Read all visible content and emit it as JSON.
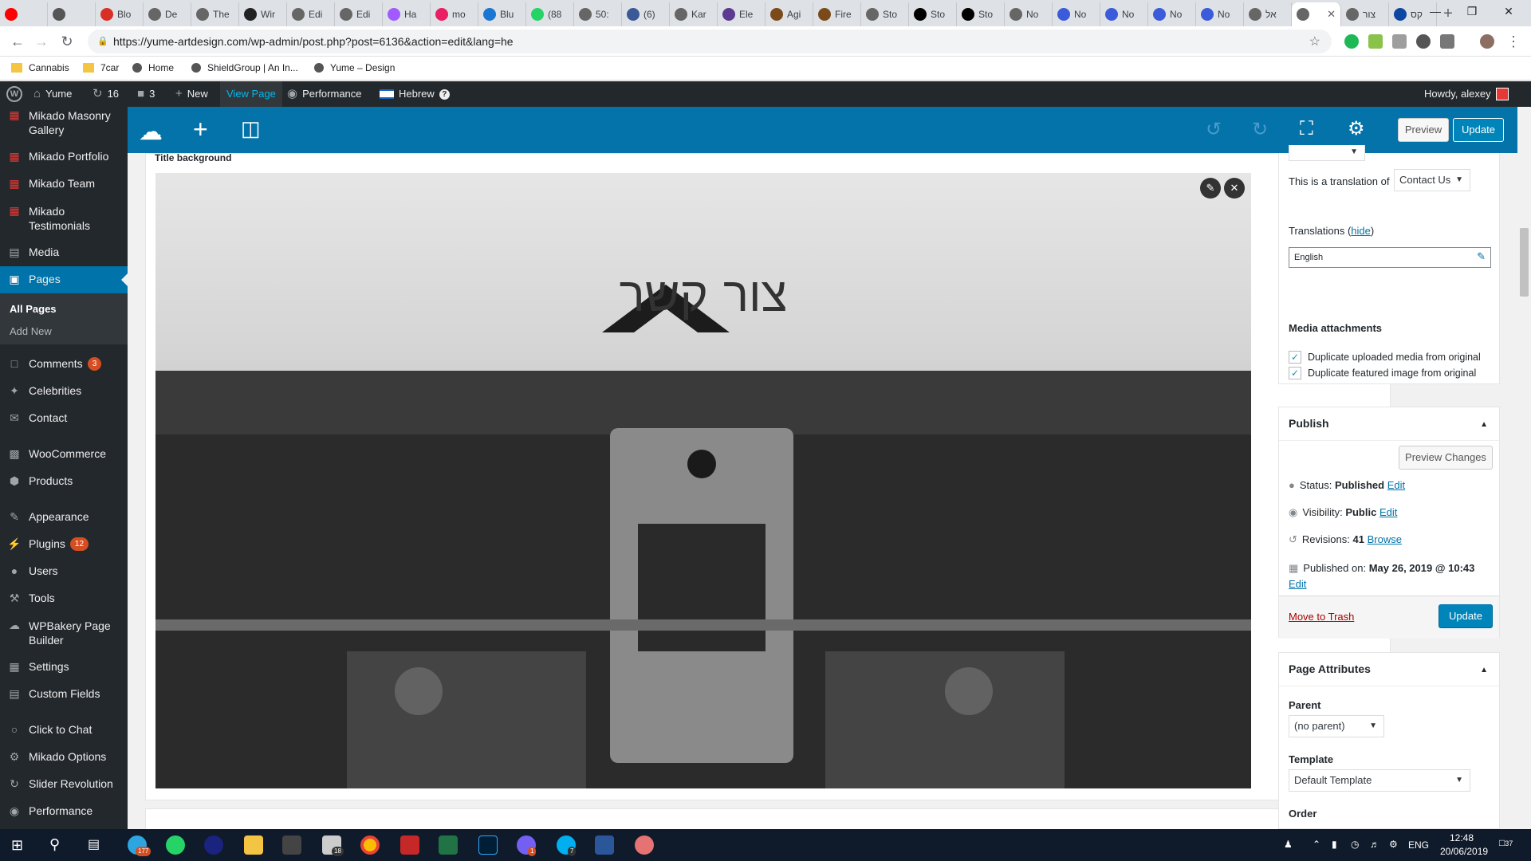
{
  "browser": {
    "tabs": [
      {
        "label": "",
        "color": "#ff0000"
      },
      {
        "label": "",
        "color": "#555"
      },
      {
        "label": "Blo",
        "color": "#d93025"
      },
      {
        "label": "De",
        "color": "#666"
      },
      {
        "label": "The",
        "color": "#666"
      },
      {
        "label": "Wir",
        "color": "#222"
      },
      {
        "label": "Edi",
        "color": "#666"
      },
      {
        "label": "Edi",
        "color": "#666"
      },
      {
        "label": "Ha",
        "color": "#a259ff"
      },
      {
        "label": "mo",
        "color": "#e91e63"
      },
      {
        "label": "Blu",
        "color": "#1976d2"
      },
      {
        "label": "(88",
        "color": "#25d366"
      },
      {
        "label": "50:",
        "color": "#666"
      },
      {
        "label": "(6)",
        "color": "#3b5998"
      },
      {
        "label": "Kar",
        "color": "#666"
      },
      {
        "label": "Ele",
        "color": "#5c3a91"
      },
      {
        "label": "Agi",
        "color": "#7a4a1a"
      },
      {
        "label": "Fire",
        "color": "#7a4a1a"
      },
      {
        "label": "Sto",
        "color": "#666"
      },
      {
        "label": "Sto",
        "color": "#000"
      },
      {
        "label": "Sto",
        "color": "#000"
      },
      {
        "label": "No",
        "color": "#666"
      },
      {
        "label": "No",
        "color": "#3b5bdb"
      },
      {
        "label": "No",
        "color": "#3b5bdb"
      },
      {
        "label": "No",
        "color": "#3b5bdb"
      },
      {
        "label": "No",
        "color": "#3b5bdb"
      },
      {
        "label": "אל",
        "color": "#666"
      },
      {
        "label": "",
        "color": "#666",
        "active": true
      },
      {
        "label": "צור",
        "color": "#666"
      },
      {
        "label": "קס",
        "color": "#0d47a1"
      }
    ],
    "url": "https://yume-artdesign.com/wp-admin/post.php?post=6136&action=edit&lang=he",
    "bookmarks": [
      "Cannabis",
      "7car",
      "Home",
      "ShieldGroup | An In...",
      "Yume – Design"
    ]
  },
  "adminbar": {
    "site": "Yume",
    "updates": "16",
    "comments": "3",
    "new": "New",
    "view": "View Page",
    "performance": "Performance",
    "language": "Hebrew",
    "howdy": "Howdy, alexey"
  },
  "sidebar": {
    "items": [
      {
        "label": "Mikado Masonry Gallery",
        "icon": "mikado-icon"
      },
      {
        "label": "Mikado Portfolio",
        "icon": "mikado-icon"
      },
      {
        "label": "Mikado Team",
        "icon": "mikado-icon"
      },
      {
        "label": "Mikado Testimonials",
        "icon": "mikado-icon"
      },
      {
        "label": "Media",
        "icon": "media-icon"
      },
      {
        "label": "Pages",
        "icon": "pages-icon"
      },
      {
        "label": "Comments",
        "icon": "comments-icon",
        "badge": "3"
      },
      {
        "label": "Celebrities",
        "icon": "pin-icon"
      },
      {
        "label": "Contact",
        "icon": "mail-icon"
      },
      {
        "label": "WooCommerce",
        "icon": "woo-icon"
      },
      {
        "label": "Products",
        "icon": "box-icon"
      },
      {
        "label": "Appearance",
        "icon": "brush-icon"
      },
      {
        "label": "Plugins",
        "icon": "plug-icon",
        "badge": "12"
      },
      {
        "label": "Users",
        "icon": "user-icon"
      },
      {
        "label": "Tools",
        "icon": "wrench-icon"
      },
      {
        "label": "WPBakery Page Builder",
        "icon": "wpb-icon"
      },
      {
        "label": "Settings",
        "icon": "settings-icon"
      },
      {
        "label": "Custom Fields",
        "icon": "fields-icon"
      },
      {
        "label": "Click to Chat",
        "icon": "chat-icon"
      },
      {
        "label": "Mikado Options",
        "icon": "gear-icon"
      },
      {
        "label": "Slider Revolution",
        "icon": "slider-icon"
      },
      {
        "label": "Performance",
        "icon": "performance-icon"
      }
    ],
    "pages_sub": [
      "All Pages",
      "Add New"
    ]
  },
  "builder": {
    "preview": "Preview",
    "update": "Update"
  },
  "content": {
    "title_bg_label": "Title background",
    "heading": "צור קשר"
  },
  "language_box": {
    "translation_of_label": "This is a translation of",
    "translation_of_value": "Contact Us",
    "translations_label": "Translations",
    "hide": "hide",
    "language_value": "English",
    "media_attachments": "Media attachments",
    "dup_media": "Duplicate uploaded media from original",
    "dup_featured": "Duplicate featured image from original"
  },
  "publish": {
    "title": "Publish",
    "preview_changes": "Preview Changes",
    "status_label": "Status:",
    "status_value": "Published",
    "visibility_label": "Visibility:",
    "visibility_value": "Public",
    "revisions_label": "Revisions:",
    "revisions_value": "41",
    "browse": "Browse",
    "published_on_label": "Published on:",
    "published_on_value": "May 26, 2019 @ 10:43",
    "edit": "Edit",
    "move_to_trash": "Move to Trash",
    "update": "Update"
  },
  "page_attributes": {
    "title": "Page Attributes",
    "parent_label": "Parent",
    "parent_value": "(no parent)",
    "template_label": "Template",
    "template_value": "Default Template",
    "order_label": "Order"
  },
  "taskbar": {
    "telegram_badge": "177",
    "mail_badge": "18",
    "viber_badge": "1",
    "skype_badge": "7",
    "lang": "ENG",
    "time": "12:48",
    "date": "20/06/2019",
    "notifications": "37"
  }
}
